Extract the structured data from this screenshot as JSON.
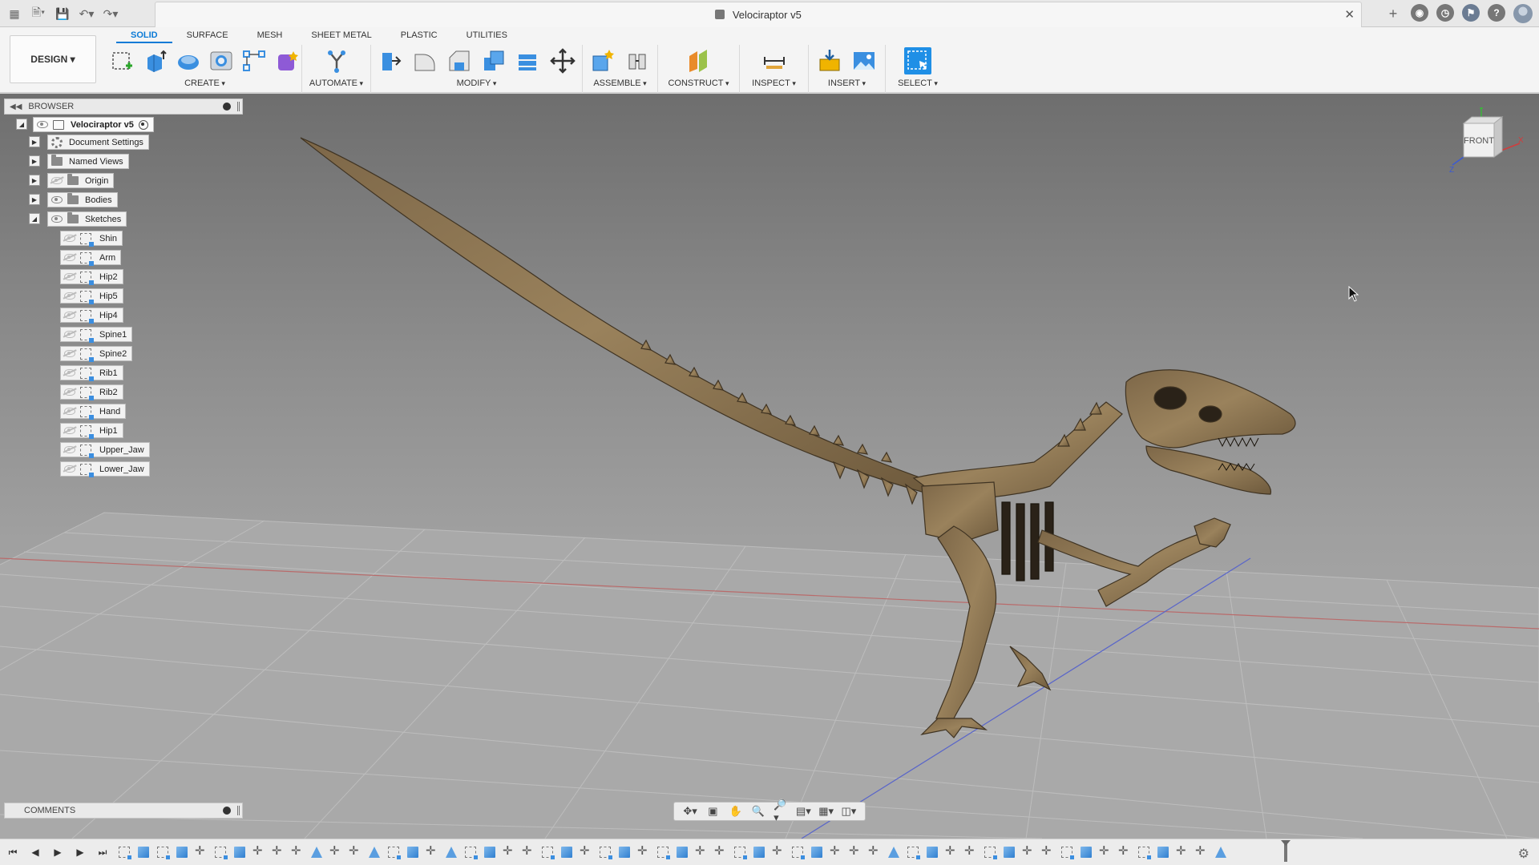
{
  "window": {
    "title": "Velociraptor v5"
  },
  "toolbar": {
    "workspace": "DESIGN",
    "tabs": [
      {
        "label": "SOLID",
        "active": true
      },
      {
        "label": "SURFACE",
        "active": false
      },
      {
        "label": "MESH",
        "active": false
      },
      {
        "label": "SHEET METAL",
        "active": false
      },
      {
        "label": "PLASTIC",
        "active": false
      },
      {
        "label": "UTILITIES",
        "active": false
      }
    ],
    "groups": {
      "create": "CREATE",
      "automate": "AUTOMATE",
      "modify": "MODIFY",
      "assemble": "ASSEMBLE",
      "construct": "CONSTRUCT",
      "inspect": "INSPECT",
      "insert": "INSERT",
      "select": "SELECT"
    }
  },
  "browser": {
    "title": "BROWSER",
    "root": "Velociraptor v5",
    "folders": [
      "Document Settings",
      "Named Views",
      "Origin",
      "Bodies",
      "Sketches"
    ],
    "sketches": [
      "Shin",
      "Arm",
      "Hip2",
      "Hip5",
      "Hip4",
      "Spine1",
      "Spine2",
      "Rib1",
      "Rib2",
      "Hand",
      "Hip1",
      "Upper_Jaw",
      "Lower_Jaw"
    ]
  },
  "viewcube": {
    "face": "FRONT",
    "axis_x": "X",
    "axis_z": "Z"
  },
  "comments": {
    "title": "COMMENTS"
  },
  "colors": {
    "accent": "#0a7ad6",
    "model_wood": "#8a7352",
    "grid_x_axis": "#c0504d",
    "grid_y_axis": "#4a5bd6"
  }
}
